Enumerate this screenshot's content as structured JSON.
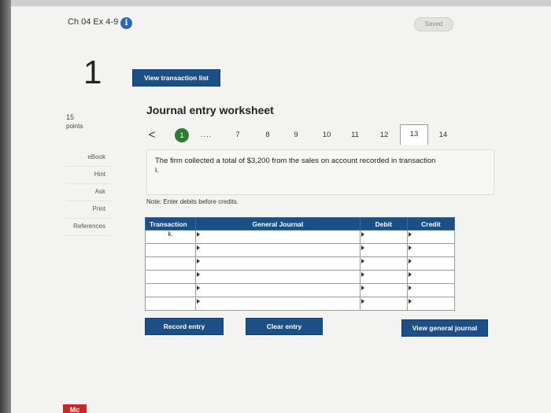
{
  "header": {
    "title": "Ch 04 Ex 4-9",
    "status_label": "Saved"
  },
  "question": {
    "number": "1",
    "points_value": "15",
    "points_label": "points"
  },
  "side_tools": [
    "eBook",
    "Hint",
    "Ask",
    "Print",
    "References"
  ],
  "toolbar": {
    "view_transaction_list_label": "View transaction list"
  },
  "worksheet": {
    "title": "Journal entry worksheet",
    "pager": {
      "prev_symbol": "<",
      "current": "1",
      "ellipsis": "....",
      "pages": [
        "7",
        "8",
        "9",
        "10",
        "11",
        "12",
        "13",
        "14"
      ],
      "active_page": "13"
    },
    "prompt": "The firm collected a total of $3,200 from the sales on account recorded in transaction i.",
    "note": "Note: Enter debits before credits.",
    "table": {
      "headers": {
        "transaction": "Transaction",
        "general_journal": "General Journal",
        "debit": "Debit",
        "credit": "Credit"
      },
      "rows": [
        {
          "transaction": "k.",
          "account": "",
          "debit": "",
          "credit": ""
        },
        {
          "transaction": "",
          "account": "",
          "debit": "",
          "credit": ""
        },
        {
          "transaction": "",
          "account": "",
          "debit": "",
          "credit": ""
        },
        {
          "transaction": "",
          "account": "",
          "debit": "",
          "credit": ""
        },
        {
          "transaction": "",
          "account": "",
          "debit": "",
          "credit": ""
        },
        {
          "transaction": "",
          "account": "",
          "debit": "",
          "credit": ""
        }
      ]
    },
    "buttons": {
      "record_entry": "Record entry",
      "clear_entry": "Clear entry",
      "view_general_journal": "View general journal"
    }
  },
  "footer": {
    "brand": "Mc"
  },
  "colors": {
    "primary_button": "#1c4f86",
    "current_page": "#2e7d32",
    "brand": "#c62828"
  }
}
